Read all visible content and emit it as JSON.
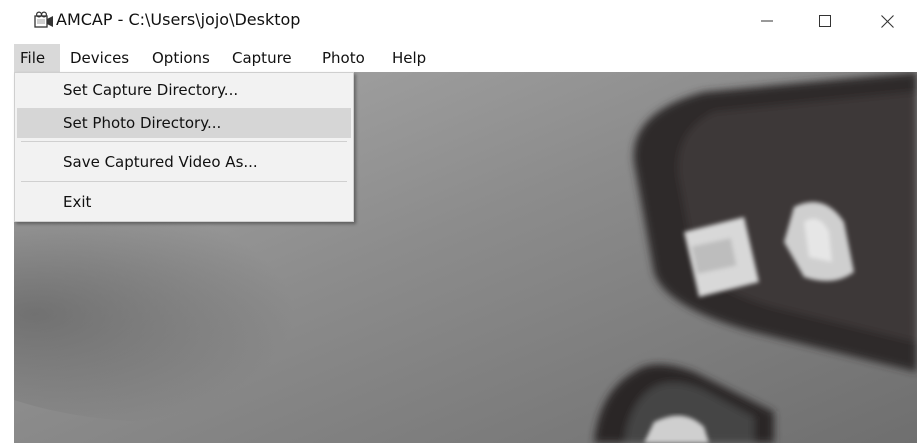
{
  "window": {
    "title": "AMCAP - C:\\Users\\jojo\\Desktop",
    "app_icon": "camera-icon",
    "controls": {
      "minimize_glyph": "—",
      "maximize_glyph": "☐",
      "close_glyph": "✕"
    }
  },
  "menubar": {
    "items": [
      {
        "label": "File",
        "active": true
      },
      {
        "label": "Devices"
      },
      {
        "label": "Options"
      },
      {
        "label": "Capture"
      },
      {
        "label": "Photo"
      },
      {
        "label": "Help"
      }
    ]
  },
  "file_menu": {
    "items": [
      {
        "label": "Set Capture Directory..."
      },
      {
        "label": "Set Photo Directory...",
        "highlighted": true
      },
      {
        "label": "Save Captured Video As..."
      },
      {
        "label": "Exit"
      }
    ]
  },
  "colors": {
    "menu_highlight": "#d6d6d6",
    "menu_background": "#f2f2f2"
  }
}
